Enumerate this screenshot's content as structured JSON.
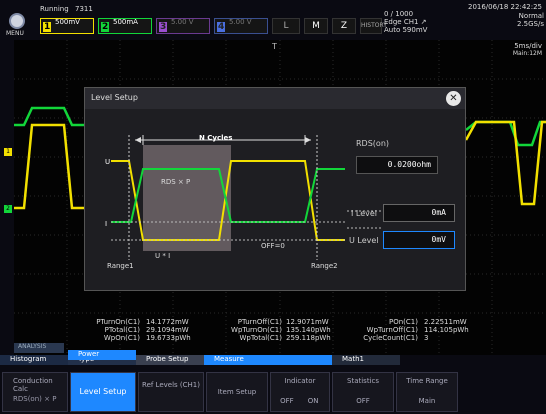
{
  "topbar": {
    "menu_label": "MENU",
    "status": "Running",
    "trigger_count": "7311",
    "ch1": {
      "num": "1",
      "scale": "500mV"
    },
    "ch2": {
      "num": "2",
      "scale": "500mA"
    },
    "ch3": {
      "num": "3",
      "scale": "5.00 V"
    },
    "ch4": {
      "num": "4",
      "scale": "5.00 V"
    },
    "l_label": "L",
    "m_label": "M",
    "z_label": "Z",
    "history_label": "HISTORY",
    "acq_count": "0 / 1000",
    "trig_line1": "Edge CH1 ↗",
    "trig_line2": "Auto 590mV",
    "datetime": "2016/06/18 22:42:25",
    "mode": "Normal",
    "sample_rate": "2.5GS/s",
    "time_div": "5ms/div",
    "record_len": "Main:12M",
    "trigger_marker": "T"
  },
  "dialog": {
    "title": "Level Setup",
    "n_cycles": "N Cycles",
    "rds_label": "RDS(on)",
    "rds_value": "0.0200ohm",
    "rds_formula": "RDS × P",
    "u_label": "U",
    "i_label": "I",
    "ui_label": "U * I",
    "off_label": "OFF=0",
    "range1": "Range1",
    "range2": "Range2",
    "i_level_label": "I Level",
    "i_level_value": "0mA",
    "u_level_label": "U Level",
    "u_level_value": "0mV"
  },
  "measurements": {
    "col1_labels": [
      "PTurnOn(C1)",
      "PTotal(C1)",
      "WpOn(C1)"
    ],
    "col1_values": [
      "14.1772mW",
      "29.1094mW",
      "19.6733pWh"
    ],
    "col2_labels": [
      "PTurnOff(C1)",
      "WpTurnOn(C1)",
      "WpTotal(C1)"
    ],
    "col2_values": [
      "12.9071mW",
      "135.140pWh",
      "259.118pWh"
    ],
    "col3_labels": [
      "POn(C1)",
      "WpTurnOff(C1)",
      "CycleCount(C1)"
    ],
    "col3_values": [
      "2.22511mW",
      "114.105pWh",
      "3"
    ]
  },
  "bottom": {
    "analysis_tab": "ANALYSIS",
    "histogram_tab": "Histogram",
    "type_tab": "Type",
    "power_header": "Power",
    "probe_setup_header": "Probe Setup",
    "measure_header": "Measure",
    "math_header": "Math1",
    "conduction_calc": "Conduction Calc",
    "conduction_value": "RDS(on) × P",
    "level_setup": "Level Setup",
    "ref_levels": "Ref Levels (CH1)",
    "item_setup": "Item Setup",
    "indicator": "Indicator",
    "indicator_off": "OFF",
    "indicator_on": "ON",
    "statistics": "Statistics",
    "statistics_value": "OFF",
    "time_range": "Time Range",
    "time_range_value": "Main"
  },
  "colors": {
    "ch1": "#f2e000",
    "ch2": "#12d63a",
    "ch3": "#9a4fd0",
    "ch4": "#4a6fe0",
    "highlight": "#1e88ff"
  }
}
